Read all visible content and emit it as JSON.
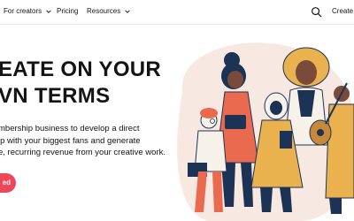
{
  "navbar": {
    "items": [
      {
        "label": "For creators",
        "has_dropdown": true
      },
      {
        "label": "Pricing",
        "has_dropdown": false
      },
      {
        "label": "Resources",
        "has_dropdown": true
      }
    ],
    "search_icon": "search-icon",
    "create_label": "Create o"
  },
  "hero": {
    "title_lines": [
      "EATE ON YOUR",
      "VN TERMS"
    ],
    "description_lines": [
      "mbership business to develop a direct",
      "ip with your biggest fans and generate",
      "e, recurring revenue from your creative work."
    ],
    "cta_label": "ed"
  },
  "colors": {
    "accent": "#f1465a",
    "text": "#141414",
    "blob": "#f7e9e2",
    "navy": "#1d3355",
    "mustard": "#e9b24f",
    "coral": "#e96a4f"
  }
}
